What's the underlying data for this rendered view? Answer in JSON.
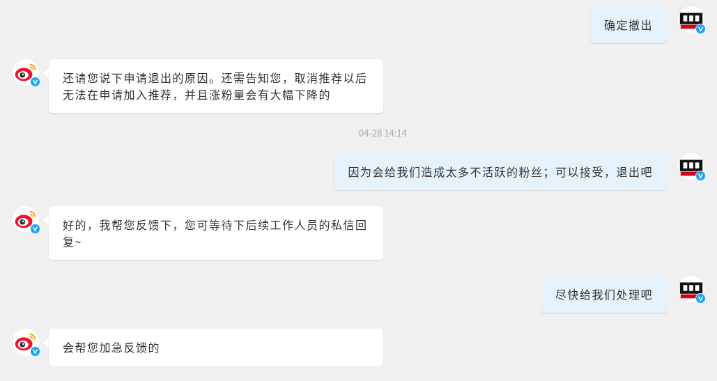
{
  "messages": [
    {
      "kind": "sent",
      "text": "确定撤出"
    },
    {
      "kind": "received",
      "text": "还请您说下申请退出的原因。还需告知您，取消推荐以后无法在申请加入推荐，并且涨粉量会有大幅下降的"
    },
    {
      "kind": "timestamp",
      "text": "04-28 14:14"
    },
    {
      "kind": "sent",
      "text": "因为会给我们造成太多不活跃的粉丝；可以接受，退出吧"
    },
    {
      "kind": "received",
      "text": "好的，我帮您反馈下，您可等待下后续工作人员的私信回复~"
    },
    {
      "kind": "sent",
      "text": "尽快给我们处理吧"
    },
    {
      "kind": "received",
      "text": "会帮您加急反馈的"
    }
  ]
}
